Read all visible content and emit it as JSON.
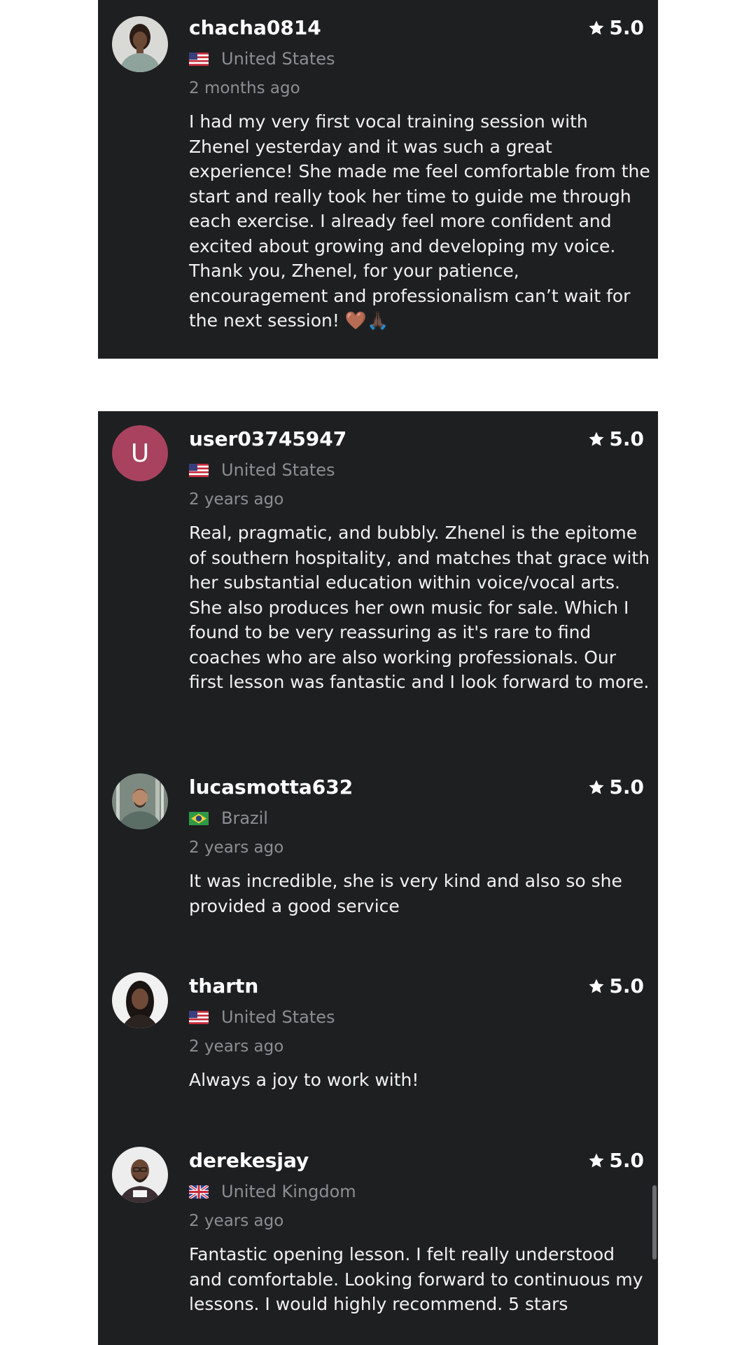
{
  "reviews": [
    {
      "username": "chacha0814",
      "rating": "5.0",
      "flag": "flag-us",
      "country": "United States",
      "time": "2 months ago",
      "text": "I had my very first vocal training session with Zhenel yesterday and it was such a great experience! She made me feel comfortable from the start and really took her time to guide me through each exercise. I already feel more confident and excited about growing and developing my voice. Thank you, Zhenel, for your patience, encouragement and professionalism can’t wait for the next session! 🤎🙏🏿",
      "avatar": "photo"
    },
    {
      "username": "user03745947",
      "rating": "5.0",
      "flag": "flag-us",
      "country": "United States",
      "time": "2 years ago",
      "text": "Real, pragmatic, and bubbly. Zhenel is the epitome of southern hospitality, and matches that grace with her substantial education within voice/vocal arts. She also produces her own music for sale. Which I found to be very reassuring as it's rare to find coaches who are also working professionals. Our first lesson was fantastic and I look forward to more.",
      "avatar": "letter",
      "avatar_letter": "U",
      "avatar_color": "#a8425f"
    },
    {
      "username": "lucasmotta632",
      "rating": "5.0",
      "flag": "flag-br",
      "country": "Brazil",
      "time": "2 years ago",
      "text": "It was incredible, she is very kind and also so she provided a good service",
      "avatar": "photo"
    },
    {
      "username": "thartn",
      "rating": "5.0",
      "flag": "flag-us",
      "country": "United States",
      "time": "2 years ago",
      "text": "Always a joy to work with!",
      "avatar": "photo"
    },
    {
      "username": "derekesjay",
      "rating": "5.0",
      "flag": "flag-gb",
      "country": "United Kingdom",
      "time": "2 years ago",
      "text": "Fantastic opening lesson. I felt really understood and comfortable. Looking forward to continuous my lessons. I would highly recommend. 5 stars",
      "avatar": "photo"
    }
  ],
  "colors": {
    "panel_bg": "#1e1f21",
    "text_primary": "#ffffff",
    "text_secondary": "#8d8e91",
    "avatar_letter_bg": "#a8425f"
  },
  "icons": {
    "rating": "star-icon"
  }
}
